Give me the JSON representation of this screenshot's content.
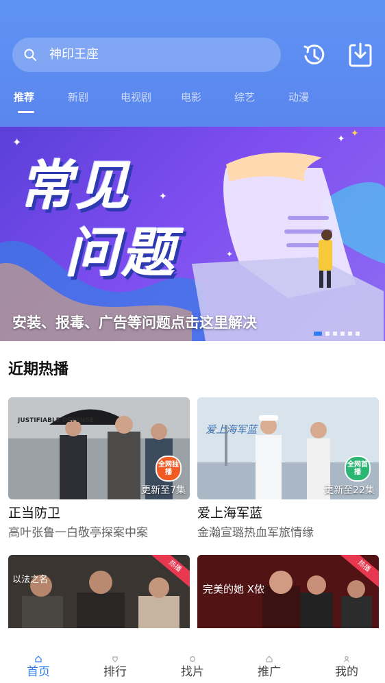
{
  "search": {
    "placeholder": "神印王座"
  },
  "header": {
    "history_icon": "history-clock-icon",
    "download_icon": "download-icon",
    "tabs": [
      {
        "label": "推荐",
        "active": true
      },
      {
        "label": "新剧"
      },
      {
        "label": "电视剧"
      },
      {
        "label": "电影"
      },
      {
        "label": "综艺"
      },
      {
        "label": "动漫"
      }
    ]
  },
  "banner": {
    "title_line1": "常见",
    "title_line2": "问题",
    "caption": "安装、报毒、广告等问题点击这里解决",
    "slides_total": 6,
    "active_slide": 1
  },
  "recent": {
    "section_title": "近期热播",
    "cards": [
      {
        "title": "正当防卫",
        "subtitle": "高叶张鲁一白敬亭探案中案",
        "episodes": "更新至7集",
        "stamp": "全网独播",
        "poster_text": "JUSTIFIABLE DEFENSE"
      },
      {
        "title": "爱上海军蓝",
        "subtitle": "金瀚宣璐热血军旅情缘",
        "episodes": "更新至22集",
        "stamp": "全网首播",
        "poster_text": "爱上海军蓝"
      },
      {
        "title": "",
        "subtitle": "",
        "episodes": "",
        "hot_badge": "热播",
        "poster_text": "以法之名"
      },
      {
        "title": "",
        "subtitle": "",
        "episodes": "",
        "hot_badge": "热播",
        "poster_text": "完美的她 X侬"
      }
    ]
  },
  "bottom_nav": [
    {
      "label": "首页",
      "active": true
    },
    {
      "label": "排行"
    },
    {
      "label": "找片"
    },
    {
      "label": "推广"
    },
    {
      "label": "我的"
    }
  ],
  "colors": {
    "accent": "#2f7bf0",
    "header": "#5a8bf0",
    "banner": "#6a45e6"
  }
}
